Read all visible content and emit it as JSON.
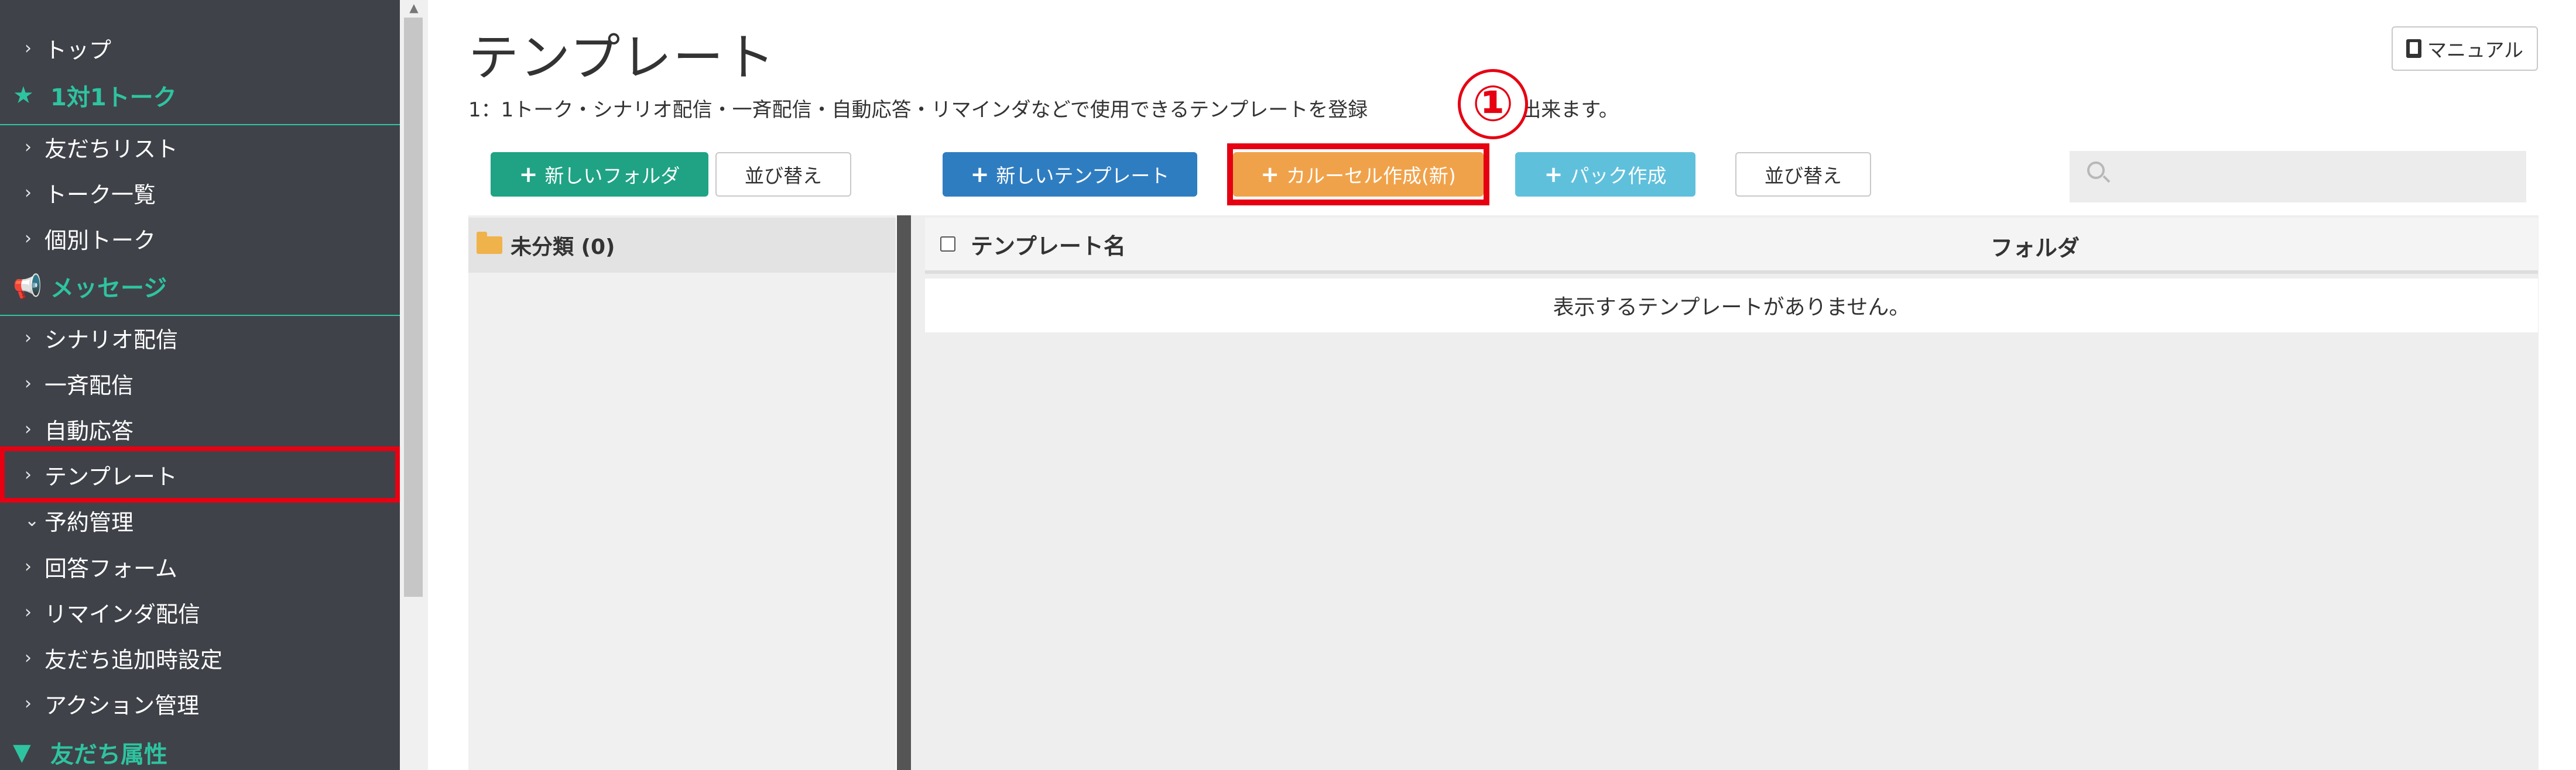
{
  "sidebar": {
    "top": "トップ",
    "section_talk": {
      "icon": "★",
      "label": "1対1トーク"
    },
    "talk_items": [
      "友だちリスト",
      "トーク一覧",
      "個別トーク"
    ],
    "section_message": {
      "icon": "📢",
      "label": "メッセージ"
    },
    "message_items": [
      {
        "label": "シナリオ配信",
        "chevron": "›"
      },
      {
        "label": "一斉配信",
        "chevron": "›"
      },
      {
        "label": "自動応答",
        "chevron": "›"
      },
      {
        "label": "テンプレート",
        "chevron": "›"
      },
      {
        "label": "予約管理",
        "chevron": "⌄"
      },
      {
        "label": "回答フォーム",
        "chevron": "›"
      },
      {
        "label": "リマインダ配信",
        "chevron": "›"
      },
      {
        "label": "友だち追加時設定",
        "chevron": "›"
      },
      {
        "label": "アクション管理",
        "chevron": "›"
      }
    ],
    "section_attributes": {
      "icon": "▼",
      "label": "友だち属性"
    }
  },
  "header": {
    "title": "テンプレート",
    "description": "1：1トーク・シナリオ配信・一斉配信・自動応答・リマインダなどで使用できるテンプレートを登録",
    "description_tail": "ことが出来ます。",
    "step_badge": "①",
    "manual_label": "マニュアル"
  },
  "toolbar": {
    "new_folder": "新しいフォルダ",
    "sort_folders": "並び替え",
    "new_template": "新しいテンプレート",
    "create_carousel": "カルーセル作成(新)",
    "create_pack": "パック作成",
    "sort_templates": "並び替え",
    "search_placeholder": ""
  },
  "folders": [
    {
      "label": "未分類 (0)"
    }
  ],
  "table": {
    "columns": [
      "テンプレート名",
      "フォルダ"
    ],
    "empty_message": "表示するテンプレートがありません。"
  },
  "colors": {
    "sidebar_bg": "#3f4249",
    "accent_teal": "#2ec4a0",
    "highlight_red": "#e60012",
    "btn_green": "#1fa384",
    "btn_blue": "#2f7dc1",
    "btn_orange": "#f0a24a",
    "btn_cyan": "#5fc0dc"
  }
}
